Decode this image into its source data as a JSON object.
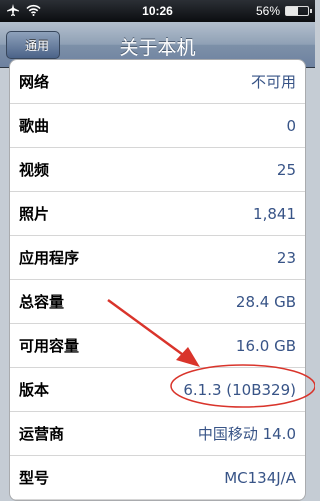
{
  "status_bar": {
    "time": "10:26",
    "battery": "56%",
    "battery_level": 0.56
  },
  "nav": {
    "back_label": "通用",
    "title": "关于本机"
  },
  "rows": [
    {
      "label": "网络",
      "value": "不可用"
    },
    {
      "label": "歌曲",
      "value": "0"
    },
    {
      "label": "视频",
      "value": "25"
    },
    {
      "label": "照片",
      "value": "1,841"
    },
    {
      "label": "应用程序",
      "value": "23"
    },
    {
      "label": "总容量",
      "value": "28.4 GB"
    },
    {
      "label": "可用容量",
      "value": "16.0 GB"
    },
    {
      "label": "版本",
      "value": "6.1.3 (10B329)"
    },
    {
      "label": "运营商",
      "value": "中国移动 14.0"
    },
    {
      "label": "型号",
      "value": "MC134J/A"
    }
  ],
  "colors": {
    "value_text": "#385487",
    "annotation_red": "#d9342b"
  }
}
